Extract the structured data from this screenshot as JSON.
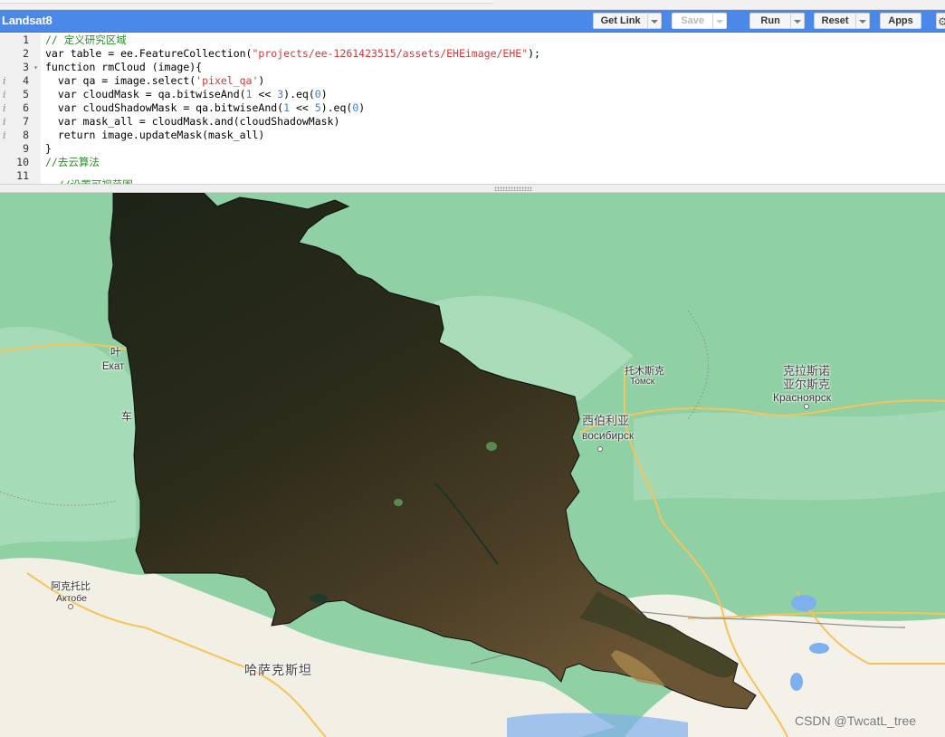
{
  "toolbar": {
    "script_title": "Landsat8",
    "buttons": {
      "get_link": "Get Link",
      "save": "Save",
      "run": "Run",
      "reset": "Reset",
      "apps": "Apps"
    },
    "settings_icon": "gear-icon"
  },
  "editor": {
    "lines": [
      {
        "n": "1",
        "info": false,
        "fold": false
      },
      {
        "n": "2",
        "info": false,
        "fold": false
      },
      {
        "n": "3",
        "info": false,
        "fold": true
      },
      {
        "n": "4",
        "info": true,
        "fold": false
      },
      {
        "n": "5",
        "info": true,
        "fold": false
      },
      {
        "n": "6",
        "info": true,
        "fold": false
      },
      {
        "n": "7",
        "info": true,
        "fold": false
      },
      {
        "n": "8",
        "info": true,
        "fold": false
      },
      {
        "n": "9",
        "info": false,
        "fold": false
      },
      {
        "n": "10",
        "info": false,
        "fold": false
      },
      {
        "n": "11",
        "info": false,
        "fold": false
      }
    ],
    "code": {
      "l1": {
        "comment": "// 定义研究区域"
      },
      "l2": {
        "a": "var table = ee.FeatureCollection(",
        "s": "\"projects/ee-1261423515/assets/EHEimage/EHE\"",
        "b": ");"
      },
      "l3": {
        "a": "function rmCloud (image){"
      },
      "l4": {
        "a": "  var qa = image.select(",
        "s": "'pixel_qa'",
        "b": ")"
      },
      "l5": {
        "a": "  var cloudMask = qa.bitwiseAnd(",
        "n1": "1",
        "m": " << ",
        "n2": "3",
        "c": ").eq(",
        "n3": "0",
        "d": ")"
      },
      "l6": {
        "a": "  var cloudShadowMask = qa.bitwiseAnd(",
        "n1": "1",
        "m": " << ",
        "n2": "5",
        "c": ").eq(",
        "n3": "0",
        "d": ")"
      },
      "l7": {
        "a": "  var mask_all = cloudMask.and(cloudShadowMask)"
      },
      "l8": {
        "a": "  return image.updateMask(mask_all)"
      },
      "l9": {
        "a": "}"
      },
      "l10": {
        "comment": "//去云算法"
      },
      "l11": {
        "comment": "  //设置可视范围"
      }
    },
    "info_marker": "i",
    "fold_marker": "▾"
  },
  "map": {
    "labels": {
      "yekaterinburg_cn": "叶",
      "yekaterinburg_ru": "Екат",
      "chelyabinsk_cn": "车",
      "tomsk_cn": "托木斯克",
      "tomsk_ru": "Томск",
      "novosibirsk_cn": "西伯利亚",
      "novosibirsk_ru": "восибирск",
      "krasnoyarsk_cn1": "克拉斯诺",
      "krasnoyarsk_cn2": "亚尔斯克",
      "krasnoyarsk_ru": "Красноярск",
      "aktobe_cn": "阿克托比",
      "aktobe_ru": "Актобе",
      "kazakhstan_cn": "哈萨克斯坦"
    },
    "watermark": "CSDN @TwcatL_tree",
    "colors": {
      "forest": "#8fd0a4",
      "forest_light": "#b4e2c2",
      "steppe": "#f3f0e6",
      "road": "#f6c35a",
      "water": "#7fb0ee",
      "imagery_dark": "#20281a",
      "imagery_mid": "#4a3d24",
      "imagery_light": "#9c7c48"
    }
  }
}
